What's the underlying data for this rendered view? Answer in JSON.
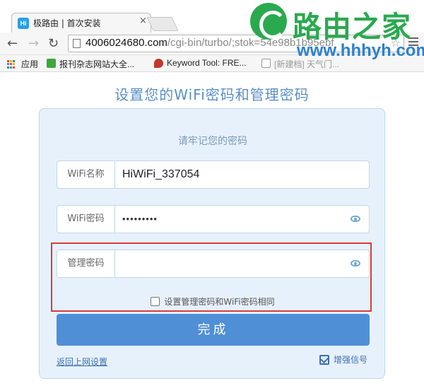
{
  "browser": {
    "tab_title": "极路由 | 首次安装",
    "tab_favicon_text": "Hi",
    "tab_close": "×",
    "url_host": "4006024680.com",
    "url_path": "/cgi-bin/turbo/;stok=54e98b1b95ebf",
    "bookmarks": [
      {
        "label": "应用",
        "icon": "apps-icon"
      },
      {
        "label": "报刊杂志网站大全...",
        "icon": "bookmark-icon",
        "color": "#3aa83a"
      },
      {
        "label": "Keyword Tool: FRE...",
        "icon": "keyword-tool-icon",
        "color": "#c0392b"
      },
      {
        "label": "[新建档] 天气门...",
        "icon": "page-icon"
      }
    ]
  },
  "watermark": {
    "text": "路由之家",
    "url": "www.hhhyh.com",
    "brand_color": "#2aa94f"
  },
  "page": {
    "heading": "设置您的WiFi密码和管理密码",
    "subheading": "请牢记您的密码",
    "fields": {
      "wifi_name": {
        "label": "WiFi名称",
        "value": "HiWiFi_337054"
      },
      "wifi_password": {
        "label": "WiFi密码",
        "value": "•••••••••"
      },
      "admin_password": {
        "label": "管理密码",
        "value": ""
      }
    },
    "same_password_checkbox": "设置管理密码和WiFi密码相同",
    "submit_label": "完成",
    "back_link": "返回上网设置",
    "boost_signal": "增强信号"
  },
  "colors": {
    "accent": "#4f8fd6",
    "card_bg": "#e7f1fb",
    "highlight": "#d63c3c"
  }
}
